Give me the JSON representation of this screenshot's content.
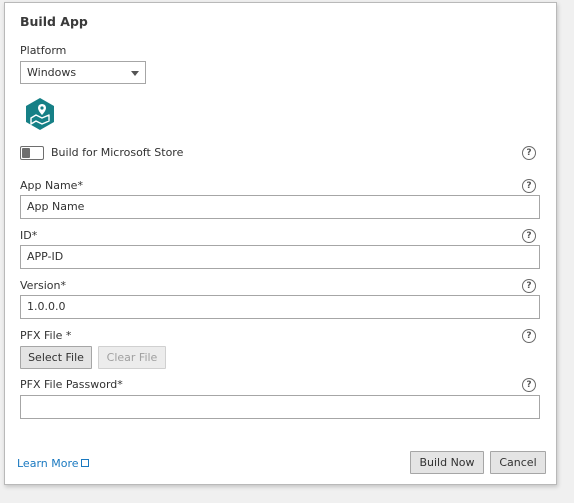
{
  "dialog": {
    "title": "Build App"
  },
  "platform": {
    "label": "Platform",
    "selected": "Windows"
  },
  "icons": {
    "app_icon": "map-app-icon",
    "help": "help-circle-icon",
    "external_link": "external-link-icon",
    "dropdown": "chevron-down-icon"
  },
  "colors": {
    "app_icon_bg": "#168086",
    "link": "#1a79c0"
  },
  "store_toggle": {
    "label": "Build for Microsoft Store",
    "checked": false
  },
  "help_glyph": "?",
  "app_name": {
    "label": "App Name*",
    "value": "App Name"
  },
  "id": {
    "label": "ID*",
    "value": "APP-ID"
  },
  "version": {
    "label": "Version*",
    "value": "1.0.0.0"
  },
  "pfx_file": {
    "label": "PFX File *",
    "select_button": "Select File",
    "clear_button": "Clear File"
  },
  "pfx_password": {
    "label": "PFX File Password*",
    "value": ""
  },
  "footer": {
    "learn_more": "Learn More",
    "build_now": "Build Now",
    "cancel": "Cancel"
  }
}
